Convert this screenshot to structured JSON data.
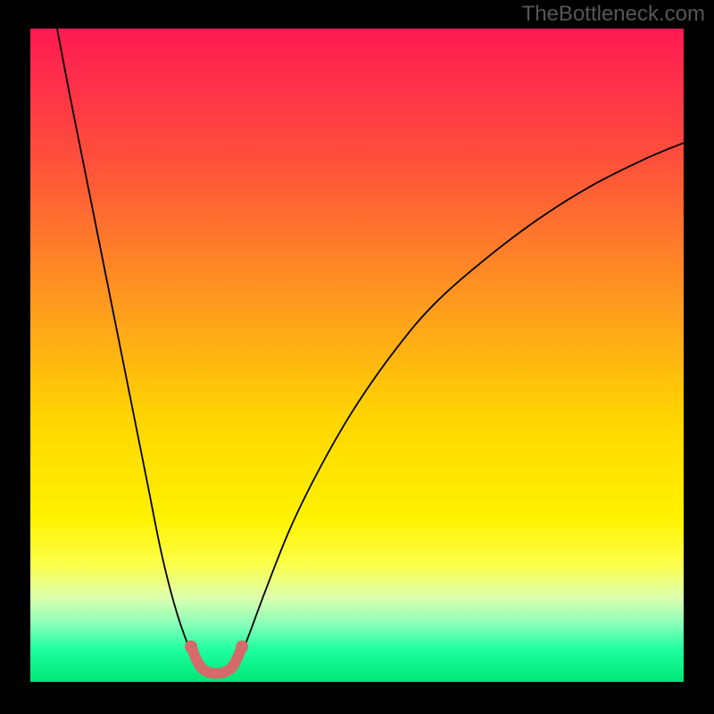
{
  "watermark": "TheBottleneck.com",
  "chart_data": {
    "type": "line",
    "title": "",
    "xlabel": "",
    "ylabel": "",
    "xlim": [
      0,
      100
    ],
    "ylim": [
      0,
      100
    ],
    "background_gradient": {
      "stops": [
        {
          "offset": 0,
          "color": "#ff1a53"
        },
        {
          "offset": 20,
          "color": "#ff4f3b"
        },
        {
          "offset": 42,
          "color": "#ff9a1e"
        },
        {
          "offset": 60,
          "color": "#ffd600"
        },
        {
          "offset": 75,
          "color": "#fff200"
        },
        {
          "offset": 82,
          "color": "#fbff4a"
        },
        {
          "offset": 87,
          "color": "#deffae"
        },
        {
          "offset": 91,
          "color": "#8cffba"
        },
        {
          "offset": 95,
          "color": "#1effa0"
        },
        {
          "offset": 100,
          "color": "#00e676"
        }
      ]
    },
    "series": [
      {
        "name": "bottleneck-curve",
        "stroke": "#000000",
        "stroke_width": 1.8,
        "points": [
          {
            "x": 4.1,
            "y": 100.0
          },
          {
            "x": 6.0,
            "y": 90.0
          },
          {
            "x": 8.0,
            "y": 80.0
          },
          {
            "x": 10.0,
            "y": 70.0
          },
          {
            "x": 12.0,
            "y": 60.0
          },
          {
            "x": 14.0,
            "y": 50.0
          },
          {
            "x": 16.0,
            "y": 40.0
          },
          {
            "x": 18.0,
            "y": 30.0
          },
          {
            "x": 20.0,
            "y": 20.0
          },
          {
            "x": 22.0,
            "y": 12.0
          },
          {
            "x": 24.0,
            "y": 6.0
          },
          {
            "x": 25.5,
            "y": 3.0
          },
          {
            "x": 27.0,
            "y": 1.5
          },
          {
            "x": 28.5,
            "y": 1.2
          },
          {
            "x": 30.0,
            "y": 1.5
          },
          {
            "x": 31.5,
            "y": 3.0
          },
          {
            "x": 33.0,
            "y": 6.0
          },
          {
            "x": 36.0,
            "y": 14.0
          },
          {
            "x": 40.0,
            "y": 24.0
          },
          {
            "x": 45.0,
            "y": 34.0
          },
          {
            "x": 50.0,
            "y": 42.5
          },
          {
            "x": 56.0,
            "y": 51.0
          },
          {
            "x": 62.0,
            "y": 58.0
          },
          {
            "x": 70.0,
            "y": 65.0
          },
          {
            "x": 78.0,
            "y": 71.0
          },
          {
            "x": 86.0,
            "y": 76.0
          },
          {
            "x": 94.0,
            "y": 80.0
          },
          {
            "x": 100.0,
            "y": 82.5
          }
        ]
      },
      {
        "name": "optimal-segment",
        "stroke": "#d46a6a",
        "stroke_width": 12,
        "linecap": "round",
        "points": [
          {
            "x": 24.6,
            "y": 5.4
          },
          {
            "x": 25.8,
            "y": 2.7
          },
          {
            "x": 27.0,
            "y": 1.6
          },
          {
            "x": 28.5,
            "y": 1.3
          },
          {
            "x": 30.0,
            "y": 1.6
          },
          {
            "x": 31.2,
            "y": 2.7
          },
          {
            "x": 32.4,
            "y": 5.4
          }
        ]
      }
    ],
    "marker_endpoints": [
      {
        "x": 24.6,
        "y": 5.4,
        "r": 7,
        "fill": "#d46a6a"
      },
      {
        "x": 32.4,
        "y": 5.4,
        "r": 7,
        "fill": "#d46a6a"
      }
    ]
  }
}
